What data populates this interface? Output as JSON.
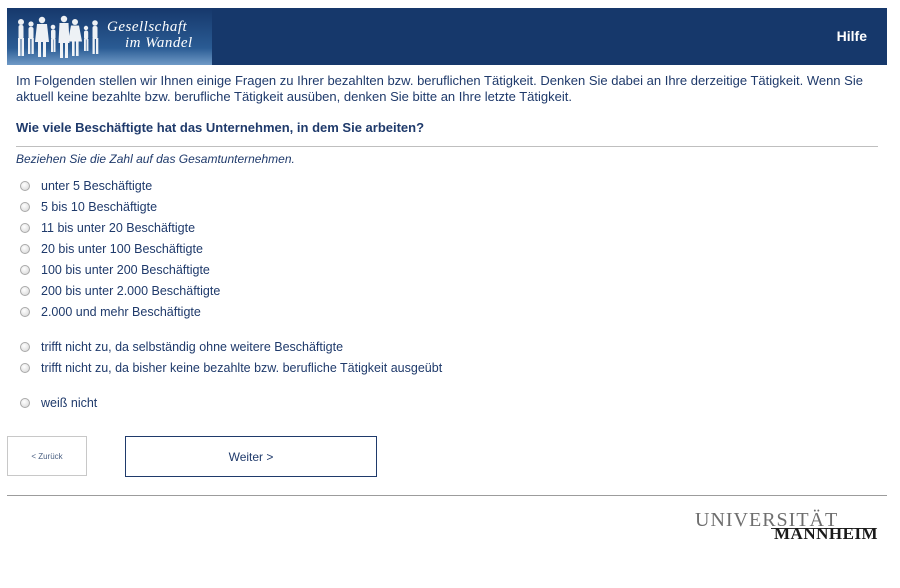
{
  "header": {
    "logo_line1": "Gesellschaft",
    "logo_line2": "im Wandel",
    "help_label": "Hilfe",
    "colors": {
      "header_bg": "#16386b",
      "text": "#1f3a6b"
    }
  },
  "intro_text": "Im Folgenden stellen wir Ihnen einige Fragen zu Ihrer bezahlten bzw. beruflichen Tätigkeit. Denken Sie dabei an Ihre derzeitige Tätigkeit. Wenn Sie aktuell keine bezahlte bzw. berufliche Tätigkeit ausüben, denken Sie bitte an Ihre letzte Tätigkeit.",
  "question": "Wie viele Beschäftigte hat das Unternehmen, in dem Sie arbeiten?",
  "instruction": "Beziehen Sie die Zahl auf das Gesamtunternehmen.",
  "options": [
    "unter 5 Beschäftigte",
    "5 bis 10 Beschäftigte",
    "11 bis unter 20 Beschäftigte",
    "20 bis unter 100 Beschäftigte",
    "100 bis unter 200 Beschäftigte",
    "200 bis unter 2.000 Beschäftigte",
    "2.000 und mehr Beschäftigte",
    "trifft nicht zu, da selbständig ohne weitere Beschäftigte",
    "trifft nicht zu, da bisher keine bezahlte bzw. berufliche Tätigkeit ausgeübt",
    "weiß nicht"
  ],
  "nav": {
    "back_label": "< Zurück",
    "next_label": "Weiter >"
  },
  "footer": {
    "logo_top": "UNIVERSITÄT",
    "logo_bottom": "MANNHEIM"
  }
}
